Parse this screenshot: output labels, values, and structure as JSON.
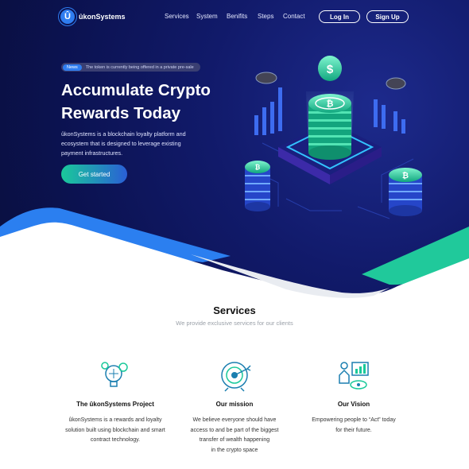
{
  "brand": {
    "name": "ûkonSystems",
    "mark": "Û"
  },
  "nav": {
    "links": [
      "Services",
      "System",
      "Benifits",
      "Steps",
      "Contact"
    ],
    "login": "Log In",
    "signup": "Sign Up"
  },
  "hero": {
    "news_badge": "News",
    "news_text": "The token is currently being offered in a private pre-sale",
    "title_line1": "Accumulate Crypto",
    "title_line2": "Rewards Today",
    "desc_line1": "ûkonSystems is a blockchain loyalty platform and",
    "desc_line2": "ecosystem that is designed to leverage existing",
    "desc_line3": "payment infrastructures.",
    "cta": "Get started"
  },
  "services": {
    "title": "Services",
    "subtitle": "We provide exclusive services for our clients",
    "cards": [
      {
        "icon": "lightbulb-gears-icon",
        "title": "The ûkonSystems Project",
        "lines": [
          "ûkonSystems is a rewards and loyalty",
          "solution built using blockchain and smart",
          "contract technology."
        ]
      },
      {
        "icon": "target-arrow-icon",
        "title": "Our mission",
        "lines": [
          "We believe everyone should have",
          "access to and be part of the biggest",
          "transfer of wealth happening",
          "in the crypto space"
        ]
      },
      {
        "icon": "vision-presenter-icon",
        "title": "Our Vision",
        "lines": [
          "Empowering people to “Act” today",
          "for their future."
        ]
      }
    ]
  },
  "colors": {
    "hero_bg": "#0b1250",
    "accent_blue": "#2f7df0",
    "accent_green": "#1ac99a"
  }
}
